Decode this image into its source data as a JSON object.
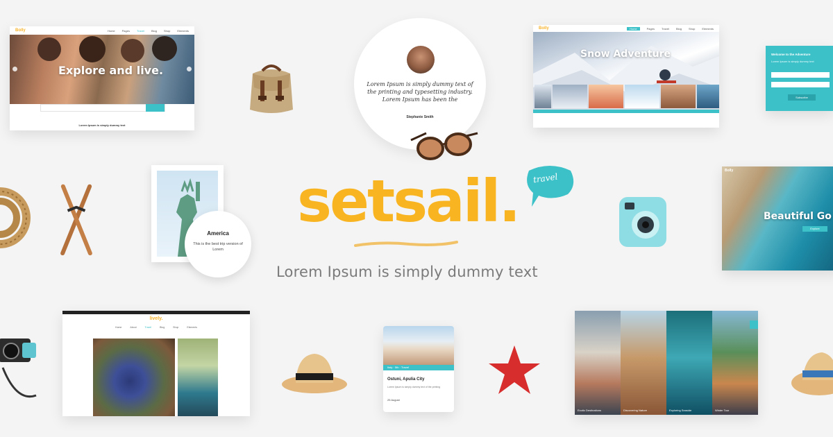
{
  "brand": {
    "name": "setsail.",
    "badge": "travel",
    "tagline": "Lorem Ipsum is simply dummy text"
  },
  "card_explore": {
    "logo": "Bolly",
    "nav": [
      "Home",
      "Pages",
      "Travel",
      "Blog",
      "Shop",
      "Elements"
    ],
    "hero": "Explore and live.",
    "footer": "Lorem Ipsum is simply dummy text",
    "search_button": "Search"
  },
  "card_snow": {
    "logo": "Bolly",
    "nav": [
      "Home",
      "Pages",
      "Travel",
      "Blog",
      "Shop",
      "Elements"
    ],
    "hero": "Snow Adventure"
  },
  "card_newsletter": {
    "title": "Welcome to the Adventure",
    "text": "Lorem Ipsum is simply dummy text",
    "button": "Subscribe"
  },
  "quote": {
    "text": "Lorem Ipsum is simply dummy text of the printing and typesetting industry. Lorem Ipsum has been the",
    "author": "Stephanie Smith"
  },
  "stamp": {
    "title": "America",
    "text": "This is the best trip version of Lorem"
  },
  "card_beautiful": {
    "logo": "Bolly",
    "hero": "Beautiful Go",
    "button": "Explore"
  },
  "card_lively": {
    "logo": "lively.",
    "nav": [
      "Home",
      "About",
      "Travel",
      "Blog",
      "Shop",
      "Elements"
    ]
  },
  "card_mobile": {
    "meta": "Italy · 5th · Travel",
    "title": "Ostuni, Apulia City",
    "text": "Lorem Ipsum is simply dummy text of the printing",
    "date": "25 August"
  },
  "card_gallery": {
    "captions": [
      "Exotic Destinations",
      "Discovering Nature",
      "Exploring Seaside",
      "Winter Tour"
    ]
  },
  "colors": {
    "accent": "#3cc1c8",
    "brand": "#f9b421",
    "background": "#f4f4f4"
  }
}
